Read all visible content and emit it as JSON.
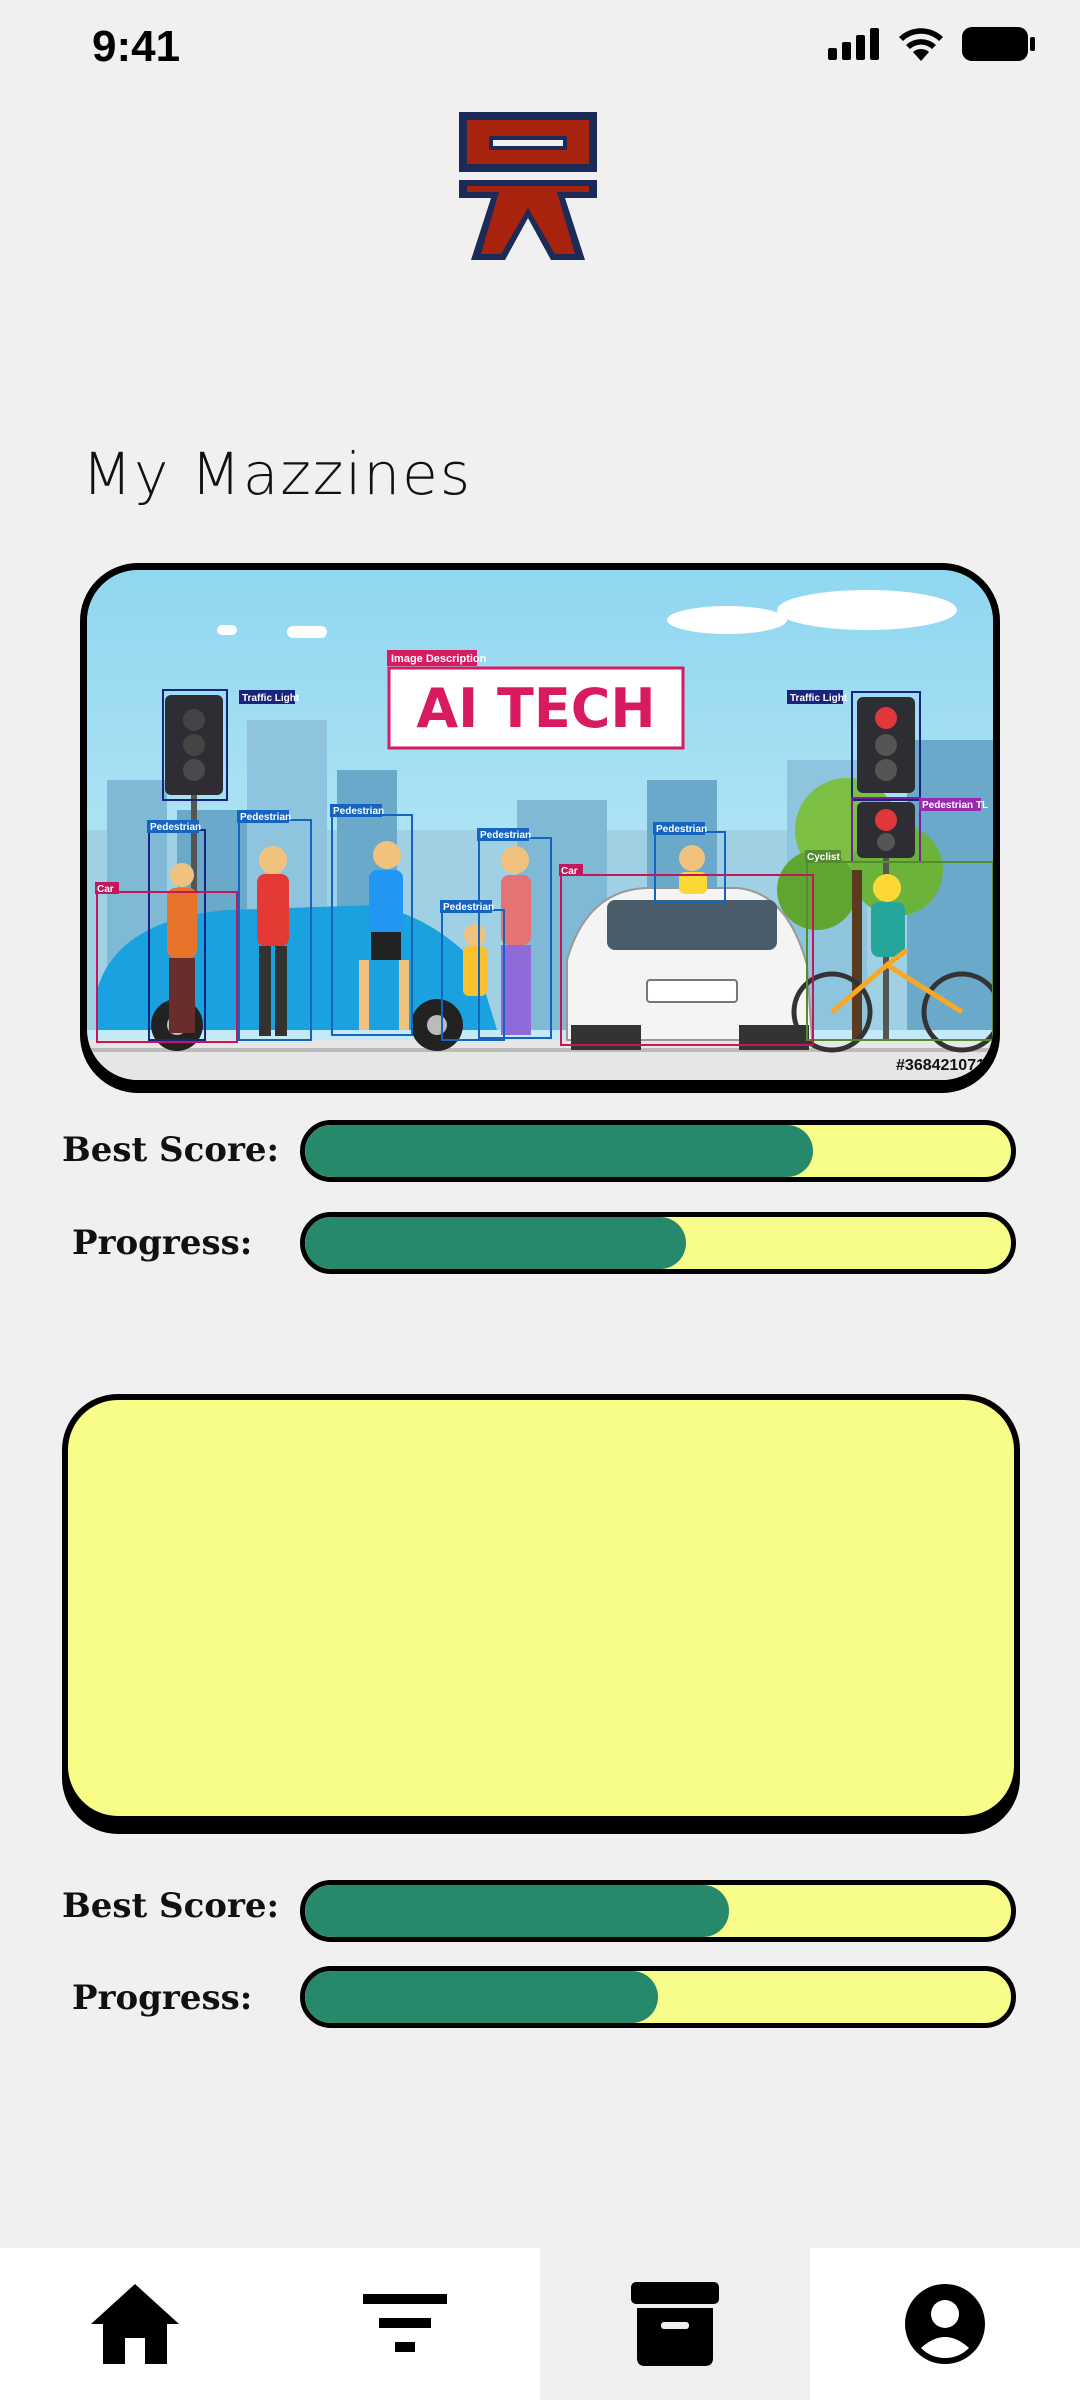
{
  "status_bar": {
    "time": "9:41",
    "icons": [
      "signal-icon",
      "wifi-icon",
      "battery-icon"
    ]
  },
  "header": {
    "logo_name": "app-logo",
    "logo_colors": {
      "fill": "#a8230e",
      "outline": "#1b2a57"
    }
  },
  "section": {
    "title": "My Mazzines"
  },
  "cards": [
    {
      "image": {
        "banner_text": "AI TECH",
        "caption": "Image Description",
        "stock_id": "#368421071",
        "labels": [
          "Traffic Light",
          "Traffic Light",
          "Pedestrian",
          "Pedestrian",
          "Pedestrian",
          "Pedestrian",
          "Pedestrian",
          "Pedestrian",
          "Pedestrian TL",
          "Car",
          "Car",
          "Cyclist"
        ]
      },
      "best_score": {
        "label": "Best Score:",
        "fraction": 0.72
      },
      "progress": {
        "label": "Progress:",
        "fraction": 0.54
      }
    },
    {
      "best_score": {
        "label": "Best Score:",
        "fraction": 0.6
      },
      "progress": {
        "label": "Progress:",
        "fraction": 0.5
      }
    }
  ],
  "bottom_nav": {
    "items": [
      {
        "icon": "home-icon",
        "active": false
      },
      {
        "icon": "filter-icon",
        "active": false
      },
      {
        "icon": "archive-icon",
        "active": true
      },
      {
        "icon": "account-icon",
        "active": false
      }
    ]
  },
  "colors": {
    "background": "#f0f0f0",
    "bar_fill": "#27896b",
    "bar_track": "#f7fd88",
    "card_yellow": "#f8fd88",
    "text": "#111111"
  }
}
